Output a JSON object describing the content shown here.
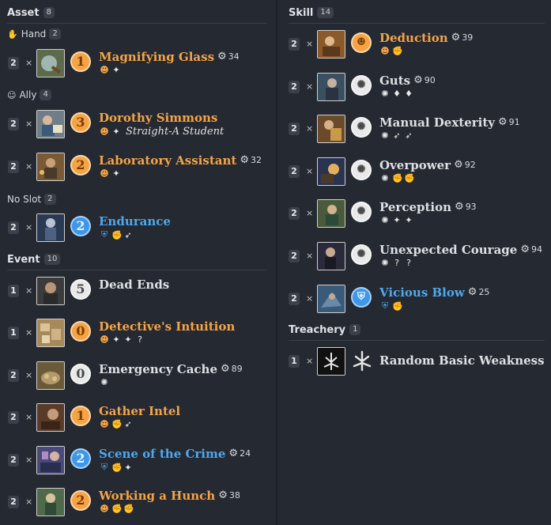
{
  "left": {
    "asset": {
      "title": "Asset",
      "count": "8"
    },
    "hand": {
      "icon": "hand-icon",
      "label": "Hand",
      "count": "2"
    },
    "ally": {
      "icon": "ally-icon",
      "label": "Ally",
      "count": "4"
    },
    "noslot": {
      "label": "No Slot",
      "count": "2"
    },
    "event": {
      "title": "Event",
      "count": "10"
    }
  },
  "right": {
    "skill": {
      "title": "Skill",
      "count": "14"
    },
    "treachery": {
      "title": "Treachery",
      "count": "1"
    }
  },
  "times_sign": "×",
  "cards": {
    "magnifying_glass": {
      "qty": "2",
      "cost": "1",
      "name": "Magnifying Glass",
      "xp": "34",
      "icons": [
        "intellect",
        "investigate"
      ]
    },
    "dorothy": {
      "qty": "2",
      "cost": "3",
      "name": "Dorothy Simmons",
      "subtitle": "Straight-A Student",
      "icons": [
        "intellect",
        "investigate"
      ]
    },
    "lab_assistant": {
      "qty": "2",
      "cost": "2",
      "name": "Laboratory Assistant",
      "xp": "32",
      "icons": [
        "intellect",
        "investigate"
      ]
    },
    "endurance": {
      "qty": "2",
      "cost": "2",
      "name": "Endurance",
      "icons": [
        "guardian",
        "combat",
        "agility"
      ]
    },
    "dead_ends": {
      "qty": "1",
      "cost": "5",
      "name": "Dead Ends"
    },
    "detectives_intuition": {
      "qty": "1",
      "cost": "0",
      "name": "Detective's Intuition",
      "icons": [
        "intellect",
        "investigate",
        "investigate",
        "wild"
      ]
    },
    "emergency_cache": {
      "qty": "2",
      "cost": "0",
      "name": "Emergency Cache",
      "xp": "89",
      "icons": [
        "neutral"
      ]
    },
    "gather_intel": {
      "qty": "2",
      "cost": "1",
      "name": "Gather Intel",
      "icons": [
        "intellect",
        "combat",
        "agility"
      ]
    },
    "scene_of_crime": {
      "qty": "2",
      "cost": "2",
      "name": "Scene of the Crime",
      "xp": "24",
      "icons": [
        "guardian",
        "combat",
        "investigate"
      ]
    },
    "working_hunch": {
      "qty": "2",
      "cost": "2",
      "name": "Working a Hunch",
      "xp": "38",
      "icons": [
        "intellect",
        "combat",
        "combat"
      ]
    },
    "deduction": {
      "qty": "2",
      "name": "Deduction",
      "xp": "39",
      "icons": [
        "intellect",
        "combat"
      ]
    },
    "guts": {
      "qty": "2",
      "name": "Guts",
      "xp": "90",
      "icons": [
        "neutral",
        "willpower",
        "willpower"
      ]
    },
    "manual_dexterity": {
      "qty": "2",
      "name": "Manual Dexterity",
      "xp": "91",
      "icons": [
        "neutral",
        "agility",
        "agility"
      ]
    },
    "overpower": {
      "qty": "2",
      "name": "Overpower",
      "xp": "92",
      "icons": [
        "neutral",
        "combat",
        "combat"
      ]
    },
    "perception": {
      "qty": "2",
      "name": "Perception",
      "xp": "93",
      "icons": [
        "neutral",
        "investigate",
        "investigate"
      ]
    },
    "unexpected_courage": {
      "qty": "2",
      "name": "Unexpected Courage",
      "xp": "94",
      "icons": [
        "neutral",
        "wild",
        "wild"
      ]
    },
    "vicious_blow": {
      "qty": "2",
      "name": "Vicious Blow",
      "xp": "25",
      "icons": [
        "guardian",
        "combat"
      ]
    },
    "random_weakness": {
      "qty": "1",
      "name": "Random Basic Weakness"
    }
  },
  "colors": {
    "seeker": "#f5a445",
    "guardian": "#4fa8ec",
    "neutral": "#dde0e4",
    "background": "#252932"
  }
}
